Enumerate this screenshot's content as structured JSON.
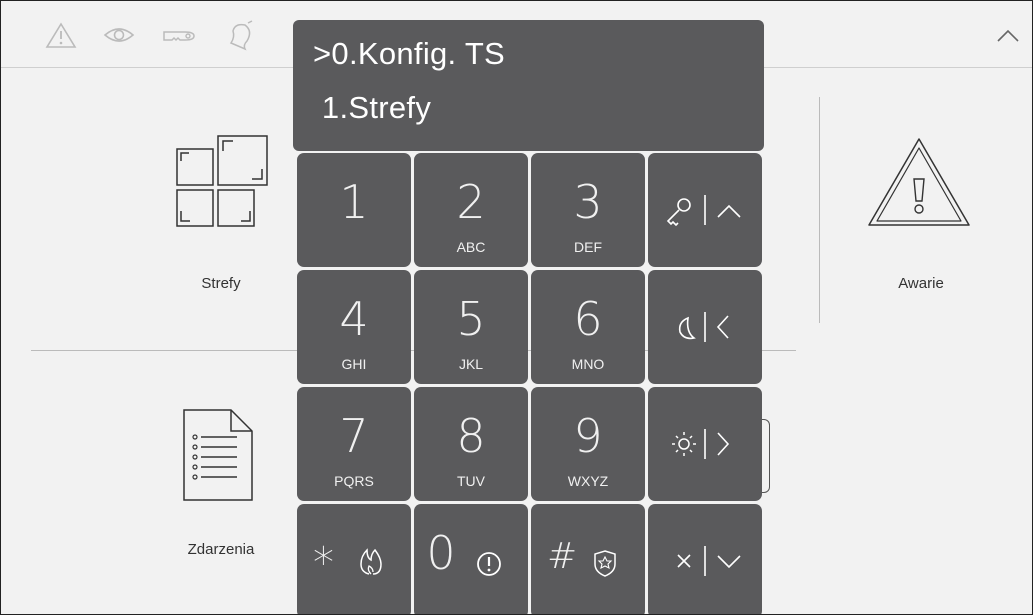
{
  "display": {
    "line1": ">0.Konfig. TS",
    "line2": " 1.Strefy"
  },
  "tiles": {
    "strefy": "Strefy",
    "awarie": "Awarie",
    "zdarzenia": "Zdarzenia"
  },
  "icons": {
    "status_bar": [
      "warning-icon",
      "eye-icon",
      "key-icon",
      "bell-icon"
    ],
    "collapse": "chevron-up-icon"
  },
  "keypad": {
    "k1": {
      "digit": "1",
      "letters": ""
    },
    "k2": {
      "digit": "2",
      "letters": "ABC"
    },
    "k3": {
      "digit": "3",
      "letters": "DEF"
    },
    "k4": {
      "digit": "4",
      "letters": "GHI"
    },
    "k5": {
      "digit": "5",
      "letters": "JKL"
    },
    "k6": {
      "digit": "6",
      "letters": "MNO"
    },
    "k7": {
      "digit": "7",
      "letters": "PQRS"
    },
    "k8": {
      "digit": "8",
      "letters": "TUV"
    },
    "k9": {
      "digit": "9",
      "letters": "WXYZ"
    },
    "k0": {
      "digit": "0"
    },
    "star": "*",
    "hash": "#",
    "function_keys": [
      "key-up-icon",
      "moon-left-icon",
      "sun-right-icon",
      "close-down-icon"
    ]
  },
  "colors": {
    "background": "#f2f2f2",
    "key": "#5a5a5c",
    "key_text": "#ffffff"
  }
}
